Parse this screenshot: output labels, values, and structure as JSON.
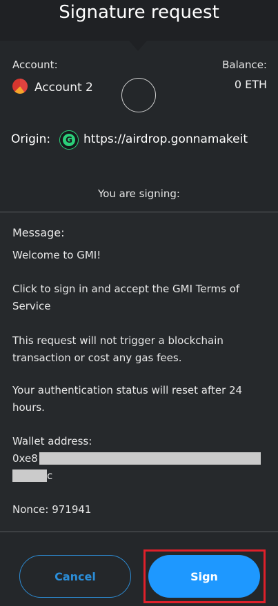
{
  "header": {
    "title": "Signature request"
  },
  "account": {
    "label": "Account:",
    "name": "Account 2"
  },
  "balance": {
    "label": "Balance:",
    "value": "0 ETH"
  },
  "origin": {
    "label": "Origin:",
    "url": "https://airdrop.gonnamakeit",
    "icon_glyph": "G"
  },
  "signing_label": "You are signing:",
  "message": {
    "heading": "Message:",
    "line1": "Welcome to GMI!",
    "line2": "Click to sign in and accept the GMI Terms of Service",
    "line3": "This request will not trigger a blockchain transaction or cost any gas fees.",
    "line4": "Your authentication status will reset after 24 hours.",
    "wallet_label": "Wallet address:",
    "wallet_prefix": "0xe8",
    "wallet_suffix": "c",
    "nonce": "Nonce: 971941"
  },
  "buttons": {
    "cancel": "Cancel",
    "sign": "Sign"
  },
  "colors": {
    "accent": "#1e98ff",
    "highlight": "#e0202a",
    "origin_icon": "#2bd07a"
  }
}
